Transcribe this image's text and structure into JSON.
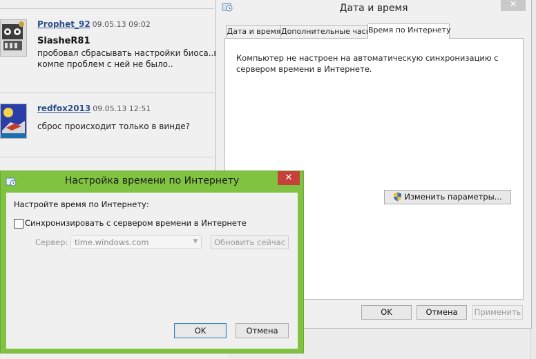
{
  "forum": {
    "posts": [
      {
        "user": "Prophet_92",
        "date": "09.05.13 09:02",
        "nick": "SlasheR81",
        "line1": "пробовал сбрасывать настройки биоса..вс",
        "line2": "компе проблем с ней не было.."
      },
      {
        "user": "redfox2013",
        "date": "09.05.13 12:51",
        "line1": "сброс происходит только в винде?"
      }
    ]
  },
  "main_dialog": {
    "title": "Дата и время",
    "close_glyph": "✕",
    "tabs": [
      {
        "label": "Дата и время"
      },
      {
        "label": "Дополнительные часы"
      },
      {
        "label": "Время по Интернету",
        "active": true
      }
    ],
    "status_text": "Компьютер не настроен на автоматическую синхронизацию с сервером времени в Интернете.",
    "change_button": "Изменить параметры...",
    "ok_button": "OK",
    "cancel_button": "Отмена",
    "apply_button": "Применить"
  },
  "sub_dialog": {
    "title": "Настройка времени по Интернету",
    "close_glyph": "✕",
    "prompt": "Настройте время по Интернету:",
    "sync_checkbox_label": "Синхронизировать с сервером времени в Интернете",
    "sync_checked": false,
    "server_label": "Сервер:",
    "server_value": "time.windows.com",
    "update_now_button": "Обновить сейчас",
    "ok_button": "OK",
    "cancel_button": "Отмена"
  },
  "icons": {
    "shield": "uac-shield-icon",
    "clock": "clock-window-icon",
    "close": "close-icon",
    "dropdown": "chevron-down-icon"
  },
  "colors": {
    "sub_frame": "#80c341",
    "close_red": "#c7413b",
    "link_blue": "#2c4f8c"
  }
}
